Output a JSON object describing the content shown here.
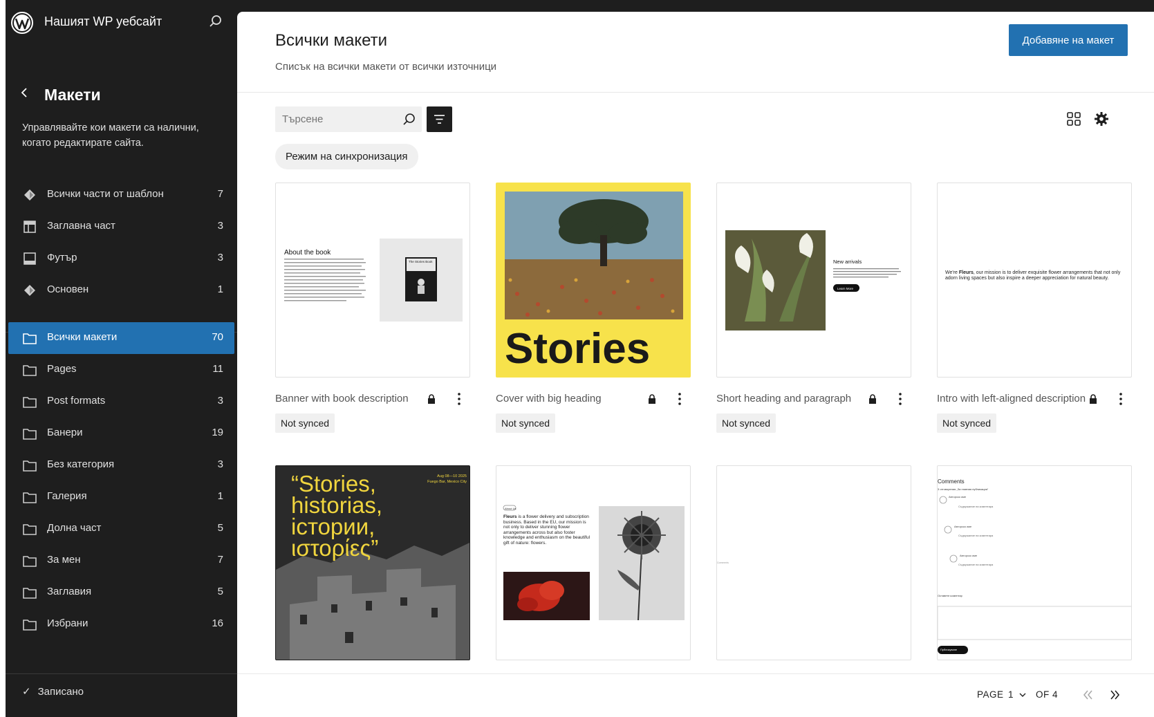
{
  "site": {
    "title": "Нашият WP уебсайт"
  },
  "sidebar": {
    "section_title": "Макети",
    "description": "Управлявайте кои макети са налични, когато редактирате сайта.",
    "template_parts": [
      {
        "label": "Всички части от шаблон",
        "count": "7",
        "icon": "diamond-icon"
      },
      {
        "label": "Заглавна част",
        "count": "3",
        "icon": "header-icon"
      },
      {
        "label": "Футър",
        "count": "3",
        "icon": "footer-icon"
      },
      {
        "label": "Основен",
        "count": "1",
        "icon": "diamond-icon"
      }
    ],
    "categories": [
      {
        "label": "Всички макети",
        "count": "70",
        "active": true
      },
      {
        "label": "Pages",
        "count": "11"
      },
      {
        "label": "Post formats",
        "count": "3"
      },
      {
        "label": "Банери",
        "count": "19"
      },
      {
        "label": "Без категория",
        "count": "3"
      },
      {
        "label": "Галерия",
        "count": "1"
      },
      {
        "label": "Долна част",
        "count": "5"
      },
      {
        "label": "За мен",
        "count": "7"
      },
      {
        "label": "Заглавия",
        "count": "5"
      },
      {
        "label": "Избрани",
        "count": "16"
      }
    ],
    "saved_status": "Записано"
  },
  "main": {
    "title": "Всички макети",
    "subtitle": "Списък на всички макети от всички източници",
    "add_button": "Добавяне на макет",
    "search_placeholder": "Търсене",
    "sync_filter": "Режим на синхронизация",
    "patterns": [
      {
        "title": "Banner with book description",
        "sync": "Not synced",
        "preview": {
          "heading": "About the book",
          "cover_text": "The Stories Book"
        }
      },
      {
        "title": "Cover with big heading",
        "sync": "Not synced",
        "preview": {
          "heading": "Stories"
        }
      },
      {
        "title": "Short heading and paragraph",
        "sync": "Not synced",
        "preview": {
          "heading": "New arrivals",
          "body": "Like flowers that bloom in unexpected places, every story unfolds with beauty and resilience, revealing hidden wonders.",
          "button": "Learn More"
        }
      },
      {
        "title": "Intro with left-aligned description",
        "sync": "Not synced",
        "preview": {
          "body_pre": "We're ",
          "body_bold": "Fleurs",
          "body_post": ", our mission is to deliver exquisite flower arrangements that not only adorn living spaces but also inspire a deeper appreciation for natural beauty."
        }
      }
    ],
    "row2": [
      {
        "quote": "“Stories, historias, істории, ιστορίες”",
        "date": "Aug 08—10 2025",
        "place": "Fuego Bar, Mexico City"
      },
      {
        "badge": "About Us",
        "body_bold": "Fleurs",
        "body": " is a flower delivery and subscription business. Based in the EU, our mission is not only to deliver stunning flower arrangements across but also foster knowledge and enthusiasm on the beautiful gift of nature: flowers."
      },
      {
        "caption": "Comments"
      },
      {
        "heading": "Comments",
        "reply_title": "3 отговорения „За главния публикация“",
        "comments": [
          "Авторско име",
          "Авторско име",
          "Авторско име"
        ],
        "comment_text": "Съдържание на коментара",
        "leave_comment": "Оставете коментар",
        "submit": "Публикуване"
      }
    ],
    "pager": {
      "page_label": "PAGE",
      "page_num": "1",
      "of_label": "OF 4"
    }
  },
  "colors": {
    "accent": "#2271b1",
    "sidebar_bg": "#1e1e1e",
    "cover_yellow": "#f7e24b"
  }
}
